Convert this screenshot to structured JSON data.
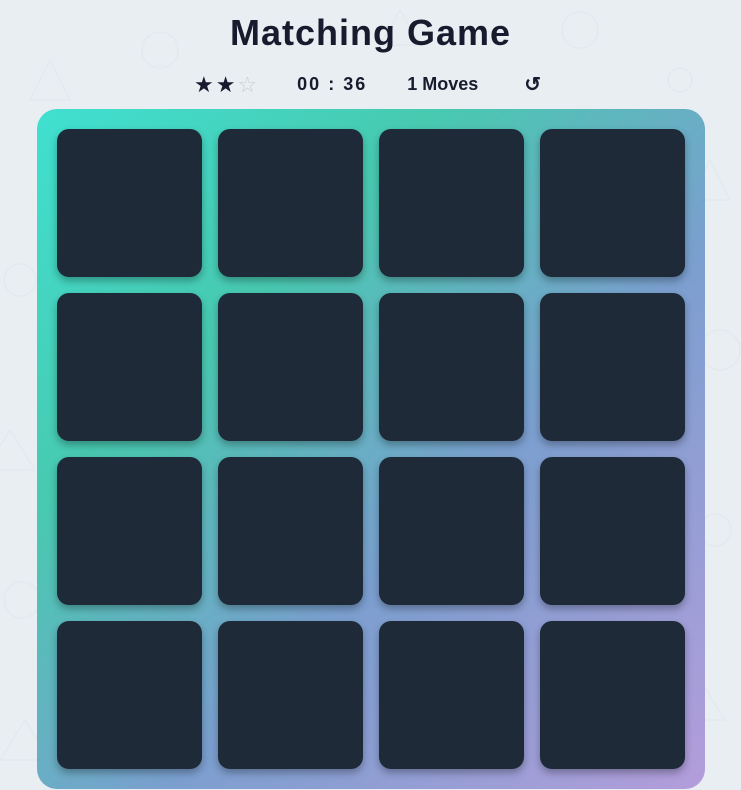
{
  "header": {
    "title": "Matching Game"
  },
  "stats": {
    "stars": [
      {
        "filled": true,
        "label": "star-1"
      },
      {
        "filled": true,
        "label": "star-2"
      },
      {
        "filled": false,
        "label": "star-3"
      }
    ],
    "timer": "00 : 36",
    "moves": "1 Moves",
    "reset_label": "↺"
  },
  "board": {
    "rows": 4,
    "cols": 4,
    "total_cards": 16
  },
  "colors": {
    "bg": "#e8eef2",
    "board_gradient_start": "#40e0d0",
    "board_gradient_end": "#b39ddb",
    "card_bg": "#1e2a38",
    "title_color": "#1a1a2e"
  }
}
